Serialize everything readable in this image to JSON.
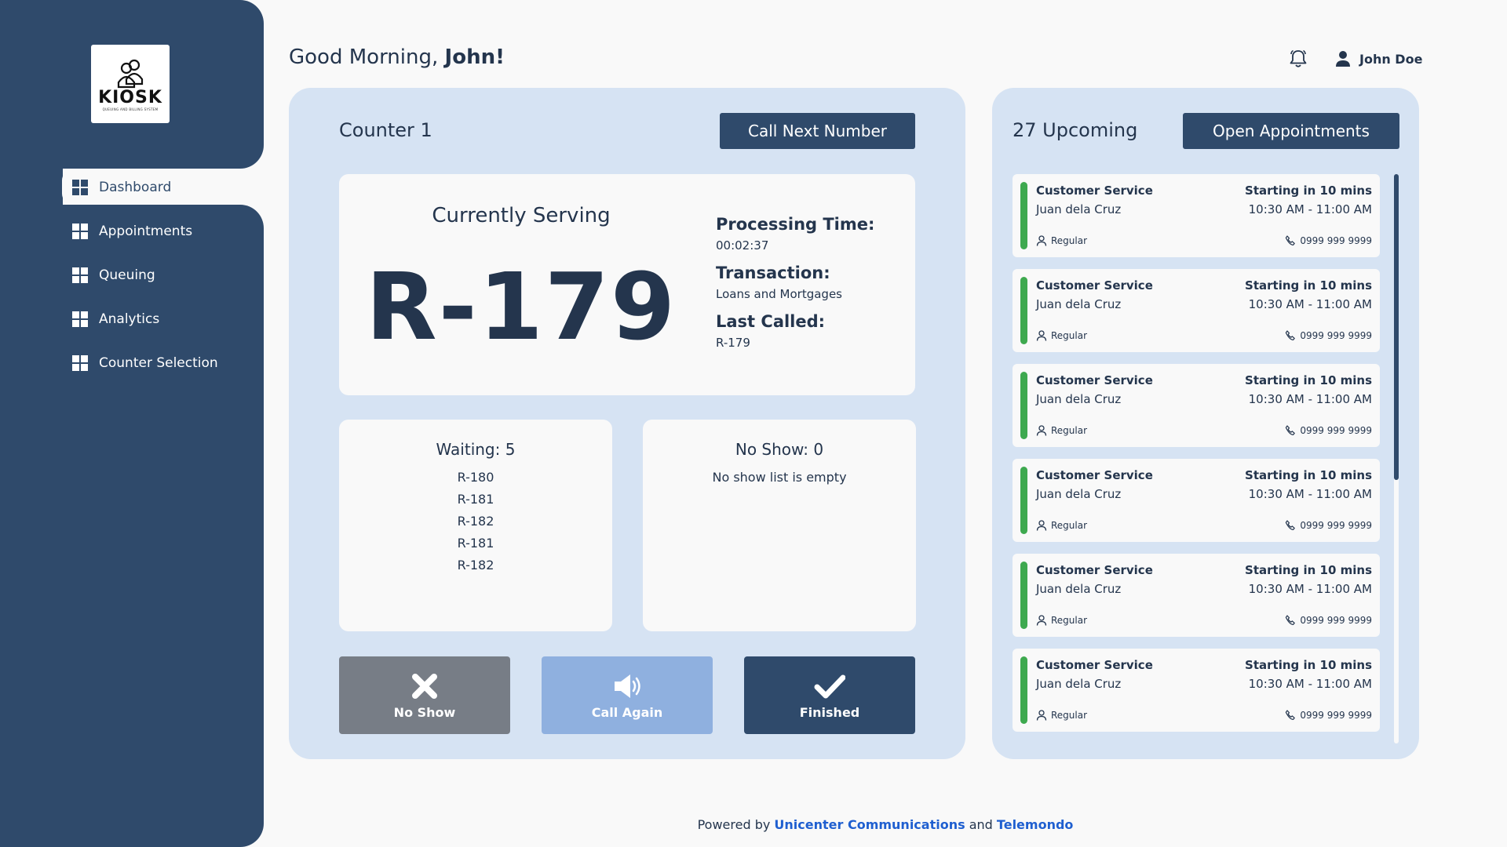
{
  "logo": {
    "text": "KIOSK",
    "subtitle": "QUEUING AND BILLING SYSTEM"
  },
  "nav": [
    {
      "label": "Dashboard",
      "icon": "dashboard-icon",
      "active": true
    },
    {
      "label": "Appointments",
      "icon": "dashboard-icon",
      "active": false
    },
    {
      "label": "Queuing",
      "icon": "dashboard-icon",
      "active": false
    },
    {
      "label": "Analytics",
      "icon": "dashboard-icon",
      "active": false
    },
    {
      "label": "Counter Selection",
      "icon": "dashboard-icon",
      "active": false
    }
  ],
  "header": {
    "greeting": "Good Morning,",
    "greeting_name": "John!",
    "user_name": "John Doe"
  },
  "counter": {
    "title": "Counter 1",
    "call_next_label": "Call Next Number",
    "serving_label": "Currently Serving",
    "serving_number": "R-179",
    "processing_time_label": "Processing Time:",
    "processing_time": "00:02:37",
    "transaction_label": "Transaction:",
    "transaction": "Loans and Mortgages",
    "last_called_label": "Last Called:",
    "last_called": "R-179",
    "waiting_title": "Waiting: 5",
    "waiting_list": [
      "R-180",
      "R-181",
      "R-182",
      "R-181",
      "R-182"
    ],
    "noshow_title": "No Show: 0",
    "noshow_empty": "No show list is empty",
    "actions": {
      "no_show": "No Show",
      "call_again": "Call Again",
      "finished": "Finished"
    }
  },
  "upcoming": {
    "title": "27 Upcoming",
    "open_label": "Open Appointments",
    "items": [
      {
        "service": "Customer Service",
        "name": "Juan dela Cruz",
        "start": "Starting in 10 mins",
        "time": "10:30 AM - 11:00 AM",
        "type": "Regular",
        "phone": "0999 999 9999"
      },
      {
        "service": "Customer Service",
        "name": "Juan dela Cruz",
        "start": "Starting in 10 mins",
        "time": "10:30 AM - 11:00 AM",
        "type": "Regular",
        "phone": "0999 999 9999"
      },
      {
        "service": "Customer Service",
        "name": "Juan dela Cruz",
        "start": "Starting in 10 mins",
        "time": "10:30 AM - 11:00 AM",
        "type": "Regular",
        "phone": "0999 999 9999"
      },
      {
        "service": "Customer Service",
        "name": "Juan dela Cruz",
        "start": "Starting in 10 mins",
        "time": "10:30 AM - 11:00 AM",
        "type": "Regular",
        "phone": "0999 999 9999"
      },
      {
        "service": "Customer Service",
        "name": "Juan dela Cruz",
        "start": "Starting in 10 mins",
        "time": "10:30 AM - 11:00 AM",
        "type": "Regular",
        "phone": "0999 999 9999"
      },
      {
        "service": "Customer Service",
        "name": "Juan dela Cruz",
        "start": "Starting in 10 mins",
        "time": "10:30 AM - 11:00 AM",
        "type": "Regular",
        "phone": "0999 999 9999"
      }
    ]
  },
  "footer": {
    "prefix": "Powered by",
    "company1": "Unicenter Communications",
    "joiner": "and",
    "company2": "Telemondo"
  },
  "colors": {
    "sidebar": "#2f4a6b",
    "panel": "#d6e3f3",
    "accent_green": "#3ea94f",
    "link": "#1f5fd0",
    "no_show": "#777d86",
    "call_again": "#8fb0df"
  }
}
